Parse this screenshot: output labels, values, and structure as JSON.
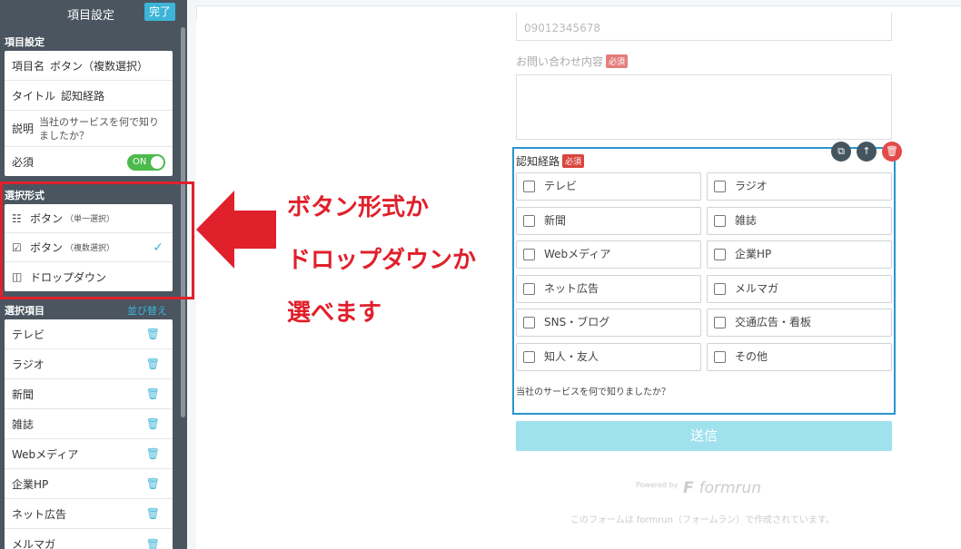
{
  "sidebar": {
    "title": "項目設定",
    "done_label": "完了",
    "section_settings": "項目設定",
    "item_name_label": "項目名",
    "item_name_value": "ボタン（複数選択）",
    "title_label": "タイトル",
    "title_value": "認知経路",
    "desc_label": "説明",
    "desc_value": "当社のサービスを何で知りましたか？",
    "required_label": "必須",
    "required_toggle": "ON",
    "section_type": "選択形式",
    "types": [
      {
        "label": "ボタン",
        "sub": "（単一選択）",
        "icon": "list-icon"
      },
      {
        "label": "ボタン",
        "sub": "（複数選択）",
        "icon": "checkbox-icon",
        "selected": true
      },
      {
        "label": "ドロップダウン",
        "sub": "",
        "icon": "dropdown-icon"
      }
    ],
    "section_items": "選択項目",
    "sort_label": "並び替え",
    "items": [
      "テレビ",
      "ラジオ",
      "新聞",
      "雑誌",
      "Webメディア",
      "企業HP",
      "ネット広告",
      "メルマガ"
    ]
  },
  "annotation": {
    "line1": "ボタン形式か",
    "line2": "ドロップダウンか",
    "line3": "選べます",
    "color": "#e0202b"
  },
  "form": {
    "phone_placeholder": "09012345678",
    "inquiry_label": "お問い合わせ内容",
    "required_badge": "必須",
    "field_label": "認知経路",
    "choices": [
      "テレビ",
      "ラジオ",
      "新聞",
      "雑誌",
      "Webメディア",
      "企業HP",
      "ネット広告",
      "メルマガ",
      "SNS・ブログ",
      "交通広告・看板",
      "知人・友人",
      "その他"
    ],
    "help_text": "当社のサービスを何で知りましたか？",
    "submit_label": "送信",
    "powered_by": "Powered by",
    "brand": "formrun",
    "footer": "このフォームは formrun（フォームラン）で作成されています。"
  }
}
